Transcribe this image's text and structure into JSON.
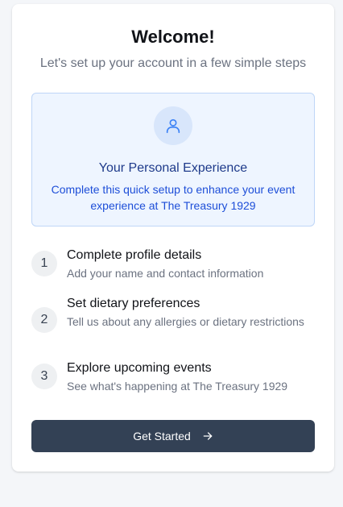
{
  "header": {
    "title": "Welcome!",
    "subtitle": "Let's set up your account in a few simple steps"
  },
  "info_box": {
    "icon": "user-icon",
    "title": "Your Personal Experience",
    "description": "Complete this quick setup to enhance your event experience at The Treasury 1929"
  },
  "steps": [
    {
      "number": "1",
      "title": "Complete profile details",
      "description": "Add your name and contact information"
    },
    {
      "number": "2",
      "title": "Set dietary preferences",
      "description": "Tell us about any allergies or dietary restrictions"
    },
    {
      "number": "3",
      "title": "Explore upcoming events",
      "description": "See what's happening at The Treasury 1929"
    }
  ],
  "action": {
    "label": "Get Started",
    "icon": "arrow-right-icon"
  },
  "colors": {
    "page_background": "#f4f6f9",
    "info_background": "#eef5ff",
    "info_border": "#bfd6f7",
    "info_title": "#1e3a8a",
    "info_text": "#1d4ed8",
    "button_background": "#334155"
  }
}
